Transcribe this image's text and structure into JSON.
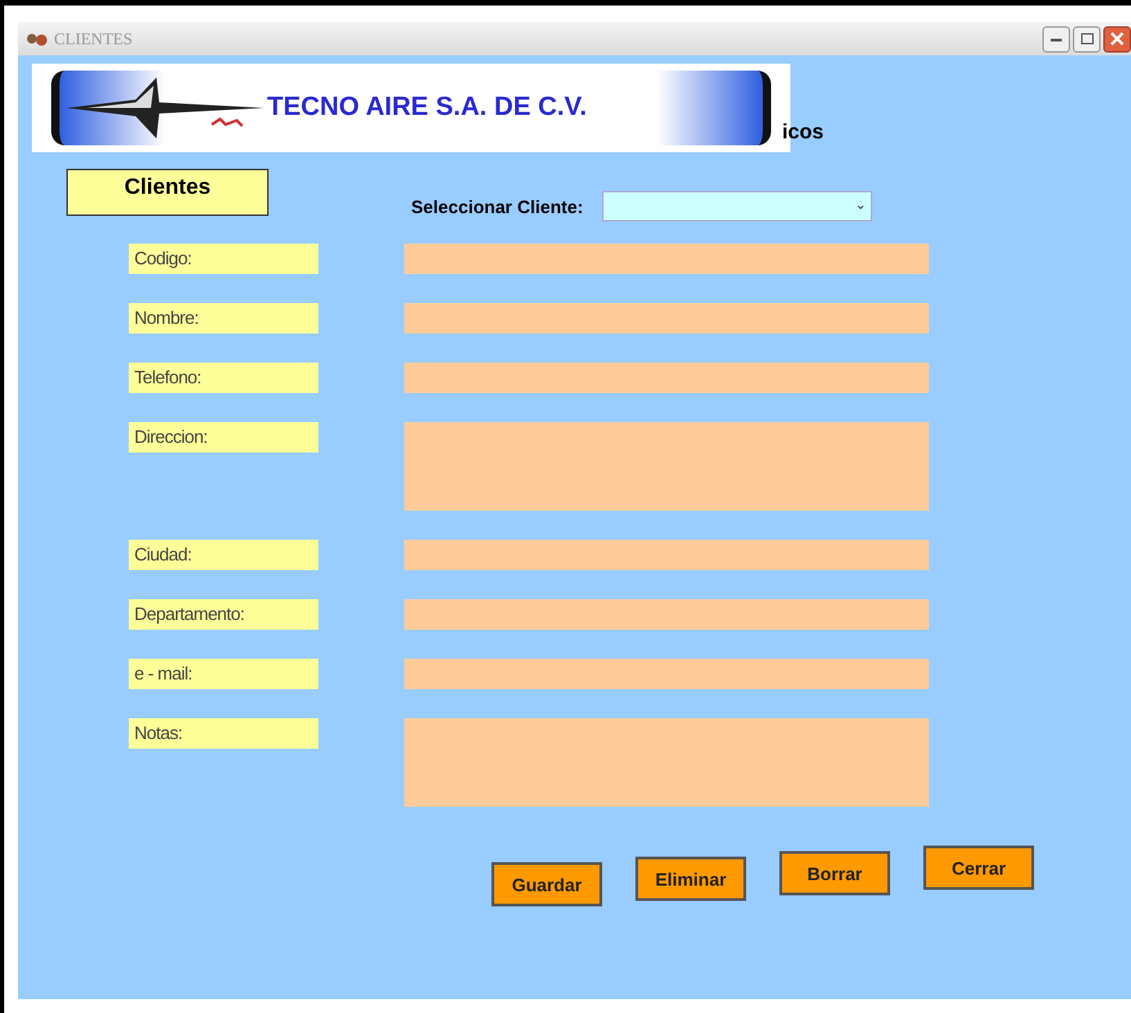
{
  "window": {
    "title": "CLIENTES"
  },
  "header": {
    "logo_text": "TECNO AIRE S.A. DE C.V.",
    "partial_title": "icos"
  },
  "section_label": "Clientes",
  "client_select": {
    "label": "Seleccionar Cliente:",
    "arrow": "⌄"
  },
  "fields": [
    {
      "label": "Codigo:",
      "kind": "line"
    },
    {
      "label": "Nombre:",
      "kind": "line"
    },
    {
      "label": "Telefono:",
      "kind": "line"
    },
    {
      "label": "Direccion:",
      "kind": "area"
    },
    {
      "label": "Ciudad:",
      "kind": "line"
    },
    {
      "label": "Departamento:",
      "kind": "line"
    },
    {
      "label": "e - mail:",
      "kind": "line"
    },
    {
      "label": "Notas:",
      "kind": "area"
    }
  ],
  "buttons": [
    "Guardar",
    "Eliminar",
    "Borrar",
    "Cerrar"
  ]
}
